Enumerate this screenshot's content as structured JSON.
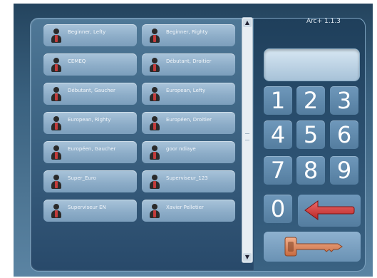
{
  "app": {
    "version": "Arc+ 1.1.3"
  },
  "users": [
    "Beginner, Lefty",
    "Beginner, Righty",
    "CEMEQ",
    "Débutant, Droitier",
    "Débutant, Gaucher",
    "European, Lefty",
    "European, Righty",
    "Européen, Droitier",
    "Européen, Gaucher",
    "goor ndiaye",
    "Super_Euro",
    "Superviseur_123",
    "Superviseur EN",
    "Xavier Pelletier"
  ],
  "keypad": {
    "keys": [
      "1",
      "2",
      "3",
      "4",
      "5",
      "6",
      "7",
      "8",
      "9",
      "0"
    ],
    "display_value": ""
  },
  "icons": {
    "user": "user-icon",
    "back": "back-arrow-icon",
    "enter": "key-icon",
    "scroll_up": "chevron-up-icon",
    "scroll_down": "chevron-down-icon"
  },
  "colors": {
    "accent_arrow": "#d23a3a",
    "key_icon": "#d8875e"
  }
}
